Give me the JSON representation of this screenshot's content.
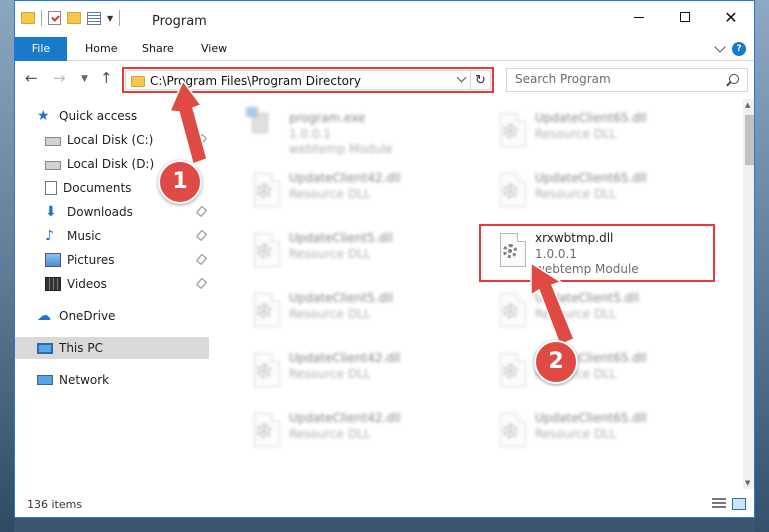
{
  "window": {
    "title": "Program"
  },
  "ribbon": {
    "tabs": [
      "File",
      "Home",
      "Share",
      "View"
    ],
    "help_label": "?"
  },
  "navbar": {
    "address": "C:\\Program Files\\Program Directory",
    "search_placeholder": "Search Program"
  },
  "sidebar": {
    "items": [
      {
        "label": "Quick access",
        "icon": "star-icon"
      },
      {
        "label": "Local Disk (C:)",
        "icon": "disk-icon"
      },
      {
        "label": "Local Disk (D:)",
        "icon": "disk-icon"
      },
      {
        "label": "Documents",
        "icon": "documents-icon"
      },
      {
        "label": "Downloads",
        "icon": "download-icon"
      },
      {
        "label": "Music",
        "icon": "music-icon"
      },
      {
        "label": "Pictures",
        "icon": "pictures-icon"
      },
      {
        "label": "Videos",
        "icon": "videos-icon"
      },
      {
        "label": "OneDrive",
        "icon": "cloud-icon"
      },
      {
        "label": "This PC",
        "icon": "pc-icon"
      },
      {
        "label": "Network",
        "icon": "network-icon"
      }
    ]
  },
  "files": [
    {
      "name": "program.exe",
      "version": "1.0.0.1",
      "desc": "webtemp Module"
    },
    {
      "name": "UpdateClient65.dll",
      "version": "",
      "desc": "Resource DLL"
    },
    {
      "name": "UpdateClient42.dll",
      "version": "",
      "desc": "Resource DLL"
    },
    {
      "name": "UpdateClient65.dll",
      "version": "",
      "desc": "Resource DLL"
    },
    {
      "name": "UpdateClient5.dll",
      "version": "",
      "desc": "Resource DLL"
    },
    {
      "name": "xrxwbtmp.dll",
      "version": "1.0.0.1",
      "desc": "webtemp Module"
    },
    {
      "name": "UpdateClient5.dll",
      "version": "",
      "desc": "Resource DLL"
    },
    {
      "name": "UpdateClient5.dll",
      "version": "",
      "desc": "Resource DLL"
    },
    {
      "name": "UpdateClient42.dll",
      "version": "",
      "desc": "Resource DLL"
    },
    {
      "name": "UpdateClient65.dll",
      "version": "",
      "desc": "Resource DLL"
    },
    {
      "name": "UpdateClient42.dll",
      "version": "",
      "desc": "Resource DLL"
    },
    {
      "name": "UpdateClient65.dll",
      "version": "",
      "desc": "Resource DLL"
    }
  ],
  "status": {
    "item_count": "136 items"
  },
  "annotations": {
    "step1": "1",
    "step2": "2",
    "color": "#e04a44"
  }
}
